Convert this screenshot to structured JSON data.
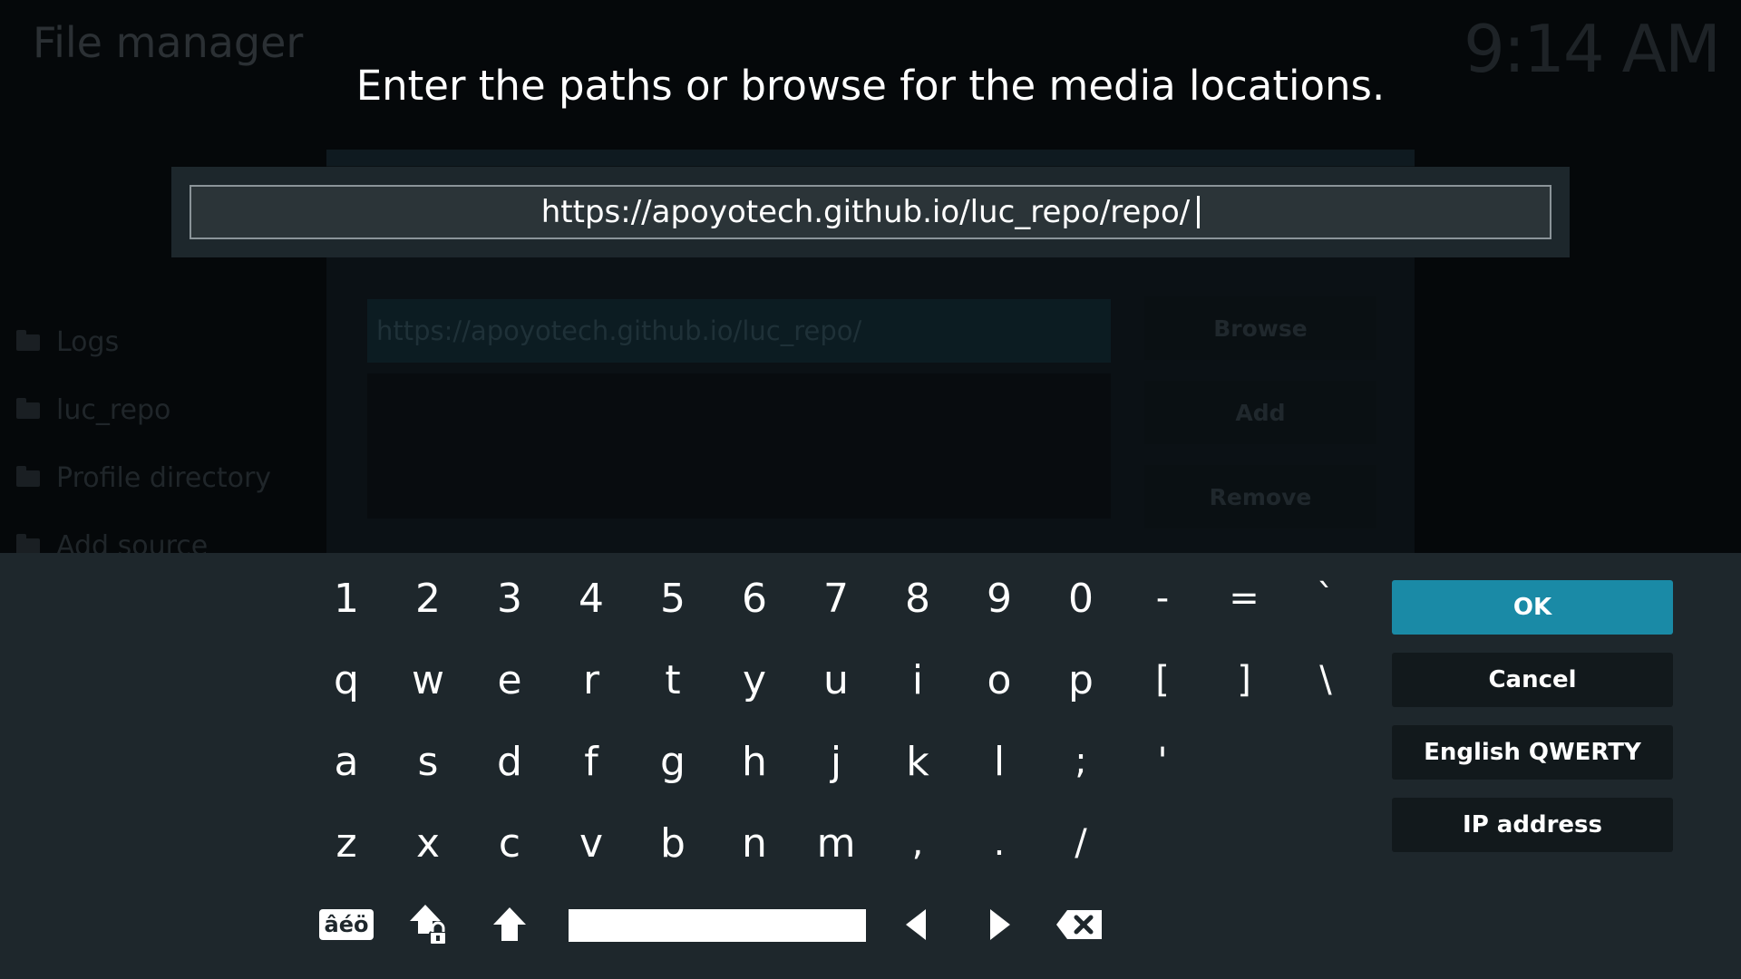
{
  "background": {
    "title": "File manager",
    "clock": "9:14 AM",
    "sources": [
      "Logs",
      "luc_repo",
      "Profile directory",
      "Add source"
    ],
    "path_value": "https://apoyotech.github.io/luc_repo/",
    "buttons": {
      "browse": "Browse",
      "add": "Add",
      "remove": "Remove"
    }
  },
  "dialog": {
    "heading": "Enter the paths or browse for the media locations.",
    "input_value": "https://apoyotech.github.io/luc_repo/repo/"
  },
  "keyboard": {
    "rows": [
      [
        "1",
        "2",
        "3",
        "4",
        "5",
        "6",
        "7",
        "8",
        "9",
        "0",
        "-",
        "=",
        "`"
      ],
      [
        "q",
        "w",
        "e",
        "r",
        "t",
        "y",
        "u",
        "i",
        "o",
        "p",
        "[",
        "]",
        "\\"
      ],
      [
        "a",
        "s",
        "d",
        "f",
        "g",
        "h",
        "j",
        "k",
        "l",
        ";",
        "'"
      ],
      [
        "z",
        "x",
        "c",
        "v",
        "b",
        "n",
        "m",
        ",",
        ".",
        "/"
      ]
    ],
    "accent_label": "âéö",
    "icons": [
      "caps-lock-icon",
      "shift-icon",
      "space-bar",
      "arrow-left-icon",
      "arrow-right-icon",
      "backspace-icon"
    ]
  },
  "side_buttons": {
    "ok": "OK",
    "cancel": "Cancel",
    "layout": "English QWERTY",
    "ip": "IP address"
  },
  "colors": {
    "ok_accent": "#1a8aa6",
    "panel": "#1e272c",
    "input_panel": "#1d272c"
  }
}
